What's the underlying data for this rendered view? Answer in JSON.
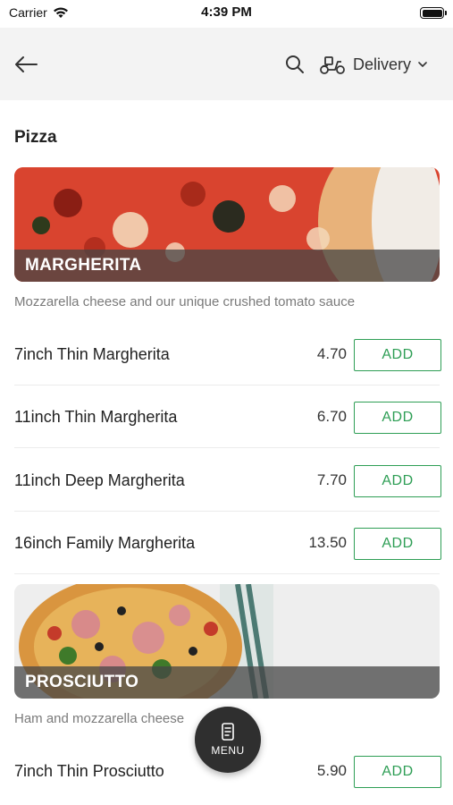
{
  "status_bar": {
    "carrier": "Carrier",
    "time": "4:39 PM"
  },
  "nav": {
    "back_icon": "arrow-left-icon",
    "search_icon": "search-icon",
    "delivery_icon": "scooter-icon",
    "delivery_label": "Delivery",
    "chevron_icon": "chevron-down-icon"
  },
  "section": {
    "title": "Pizza"
  },
  "categories": [
    {
      "name": "MARGHERITA",
      "description": "Mozzarella cheese and our unique crushed tomato sauce",
      "items": [
        {
          "name": "7inch Thin Margherita",
          "price": "4.70",
          "add_label": "ADD"
        },
        {
          "name": "11inch Thin Margherita",
          "price": "6.70",
          "add_label": "ADD"
        },
        {
          "name": "11inch Deep Margherita",
          "price": "7.70",
          "add_label": "ADD"
        },
        {
          "name": "16inch Family Margherita",
          "price": "13.50",
          "add_label": "ADD"
        }
      ]
    },
    {
      "name": "PROSCIUTTO",
      "description": "Ham and mozzarella cheese",
      "items": [
        {
          "name": "7inch Thin Prosciutto",
          "price": "5.90",
          "add_label": "ADD"
        }
      ]
    }
  ],
  "fab": {
    "icon": "menu-card-icon",
    "label": "MENU"
  },
  "colors": {
    "accent": "#2e9e55",
    "nav_bg": "#f3f3f3",
    "fab_bg": "#2f2f2f"
  }
}
